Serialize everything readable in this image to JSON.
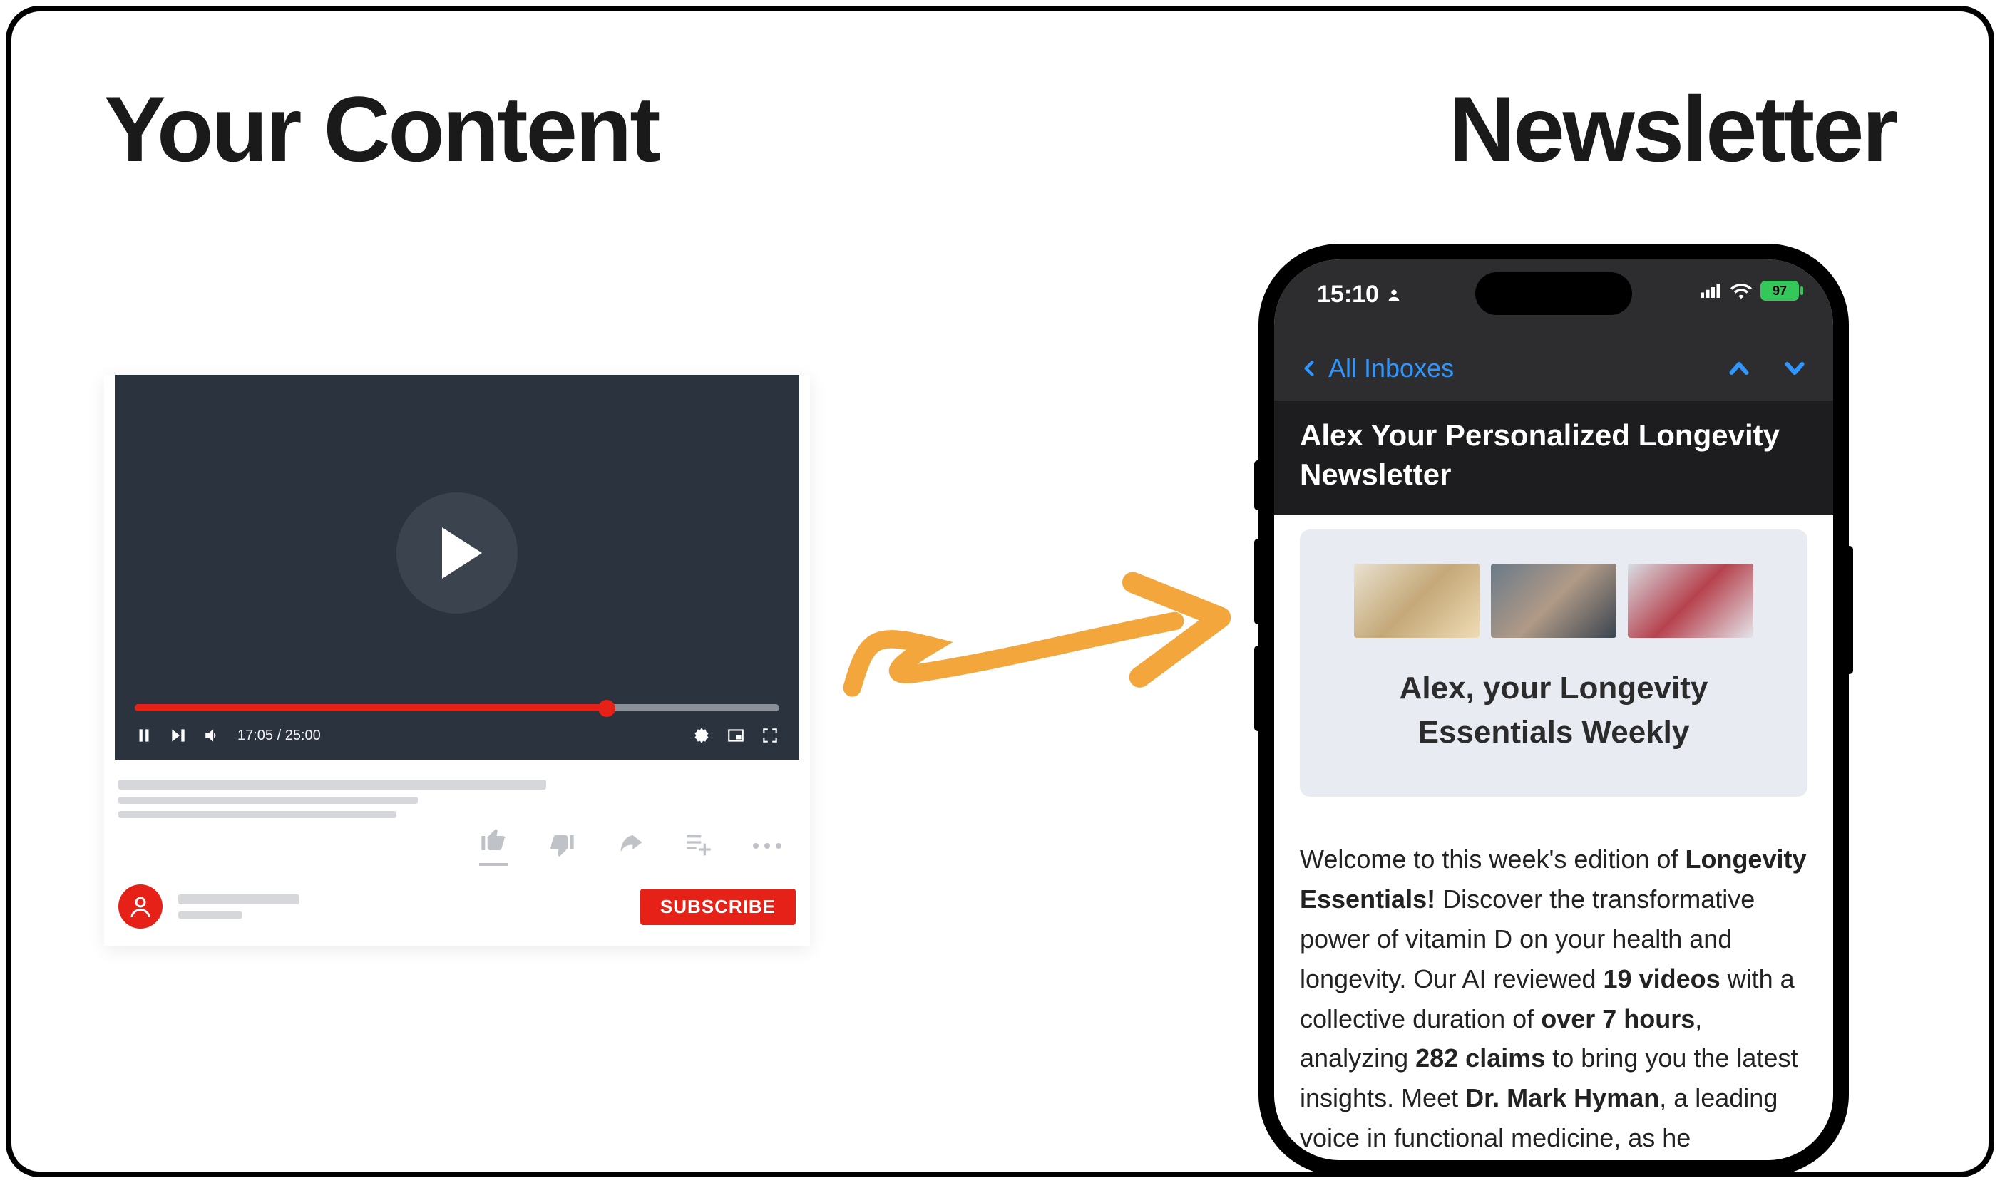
{
  "headings": {
    "left": "Your Content",
    "right": "Newsletter"
  },
  "video": {
    "time_label": "17:05 / 25:00",
    "subscribe_label": "SUBSCRIBE"
  },
  "phone": {
    "status": {
      "time": "15:10",
      "battery": "97"
    },
    "nav": {
      "back_label": "All Inboxes"
    },
    "subject": "Alex Your Personalized Longevity Newsletter",
    "hero_title": "Alex, your Longevity Essentials Weekly",
    "body": {
      "p1a": "Welcome to this week's edition of ",
      "p1b": "Longevity Essentials!",
      "p1c": " Discover the transformative power of vitamin D on your health and longevity. Our AI reviewed ",
      "p1d": "19 videos",
      "p1e": " with a collective duration of ",
      "p1f": "over 7 hours",
      "p1g": ", analyzing ",
      "p1h": "282 claims",
      "p1i": " to bring you the latest insights. Meet ",
      "p1j": "Dr. Mark Hyman",
      "p1k": ", a leading voice in functional medicine, as he"
    }
  }
}
